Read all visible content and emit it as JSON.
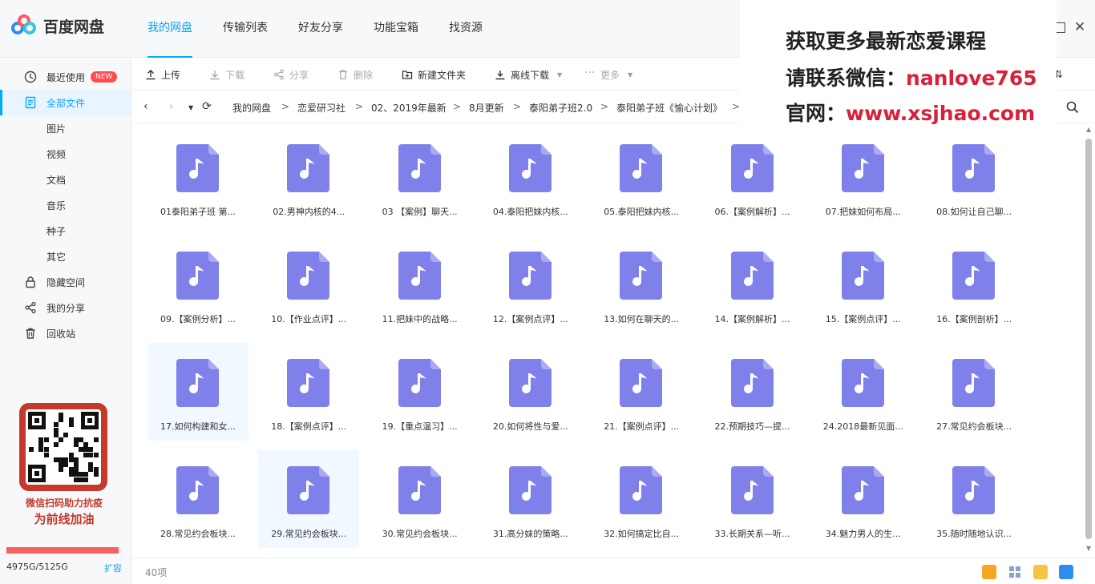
{
  "app": {
    "name": "百度网盘"
  },
  "topnav": [
    "我的网盘",
    "传输列表",
    "好友分享",
    "功能宝箱",
    "找资源"
  ],
  "sidebar": {
    "recent": "最近使用",
    "new_badge": "NEW",
    "all_files": "全部文件",
    "categories": [
      "图片",
      "视频",
      "文档",
      "音乐",
      "种子",
      "其它"
    ],
    "hidden": "隐藏空间",
    "share": "我的分享",
    "recycle": "回收站"
  },
  "promo": {
    "line1": "微信扫码助力抗疫",
    "line2": "为前线加油"
  },
  "quota": {
    "text": "4975G/5125G",
    "used_fraction": 0.97,
    "expand": "扩容"
  },
  "toolbar": {
    "upload": "上传",
    "download": "下载",
    "share": "分享",
    "delete": "删除",
    "new_folder": "新建文件夹",
    "offline": "离线下载",
    "more": "更多"
  },
  "breadcrumb": [
    "我的网盘",
    "恋爱研习社",
    "02、2019年最新",
    "8月更新",
    "泰阳弟子班2.0",
    "泰阳弟子班《愉心计划》"
  ],
  "files": [
    "01泰阳弟子班 第...",
    "02.男神内核的4...",
    "03 【案例】聊天...",
    "04.泰阳把妹内核...",
    "05.泰阳把妹内核...",
    "06.【案例解析】...",
    "07.把妹如何布局...",
    "08.如何让自己聊...",
    "09.【案例分析】...",
    "10.【作业点评】...",
    "11.把妹中的战略...",
    "12.【案例点评】...",
    "13.如何在聊天的...",
    "14.【案例解析】...",
    "15.【案例点评】...",
    "16.【案例剖析】...",
    "17.如何构建和女...",
    "18.【案例点评】...",
    "19.【重点温习】...",
    "20.如何将性与爱...",
    "21.【案例点评】...",
    "22.预期技巧—提...",
    "24.2018最新见面...",
    "27.常见约会板块...",
    "28.常见约会板块...",
    "29.常见约会板块...",
    "30.常见约会板块...",
    "31.高分妹的策略...",
    "32.如何搞定比自...",
    "33.长期关系—听...",
    "34.魅力男人的生...",
    "35.随时随地认识..."
  ],
  "highlighted_files": [
    16,
    25
  ],
  "status": {
    "count": "40项"
  },
  "overlay": {
    "line1": "获取更多最新恋爱课程",
    "line2_label": "请联系微信：",
    "line2_value": "nanlove765",
    "line3_label": "官网：",
    "line3_value": "www.xsjhao.com"
  },
  "colors": {
    "accent": "#06a7ff",
    "music_icon": "#7f80ea",
    "promo_red": "#c5392c",
    "overlay_red": "#d8203a"
  }
}
